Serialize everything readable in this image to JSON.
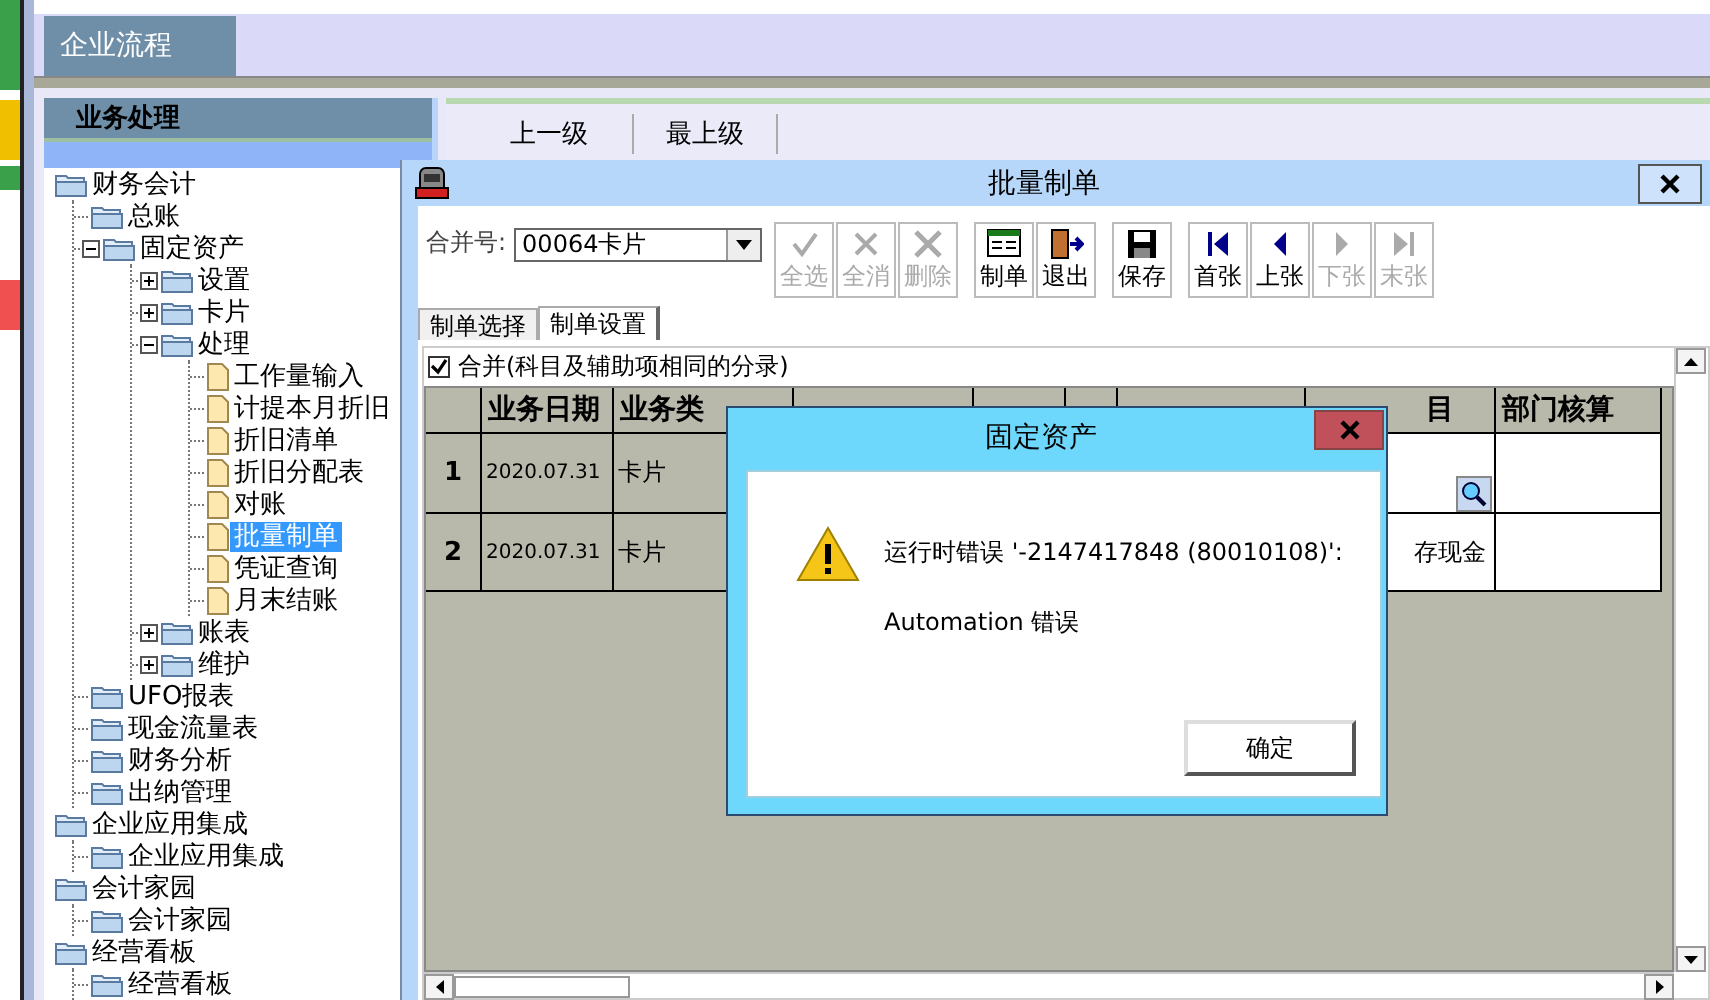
{
  "top_tabs": [
    {
      "label": "企业流程",
      "selected": true
    }
  ],
  "sidebar": {
    "title": "业务处理",
    "tree": [
      {
        "label": "财务会计",
        "kind": "folder",
        "selected": false,
        "children": [
          {
            "label": "总账",
            "kind": "folder",
            "selected": false
          },
          {
            "label": "固定资产",
            "kind": "folder",
            "selected": false,
            "expanded": true,
            "children": [
              {
                "label": "设置",
                "kind": "folder",
                "selected": false,
                "expanded": false
              },
              {
                "label": "卡片",
                "kind": "folder",
                "selected": false,
                "expanded": false
              },
              {
                "label": "处理",
                "kind": "folder",
                "selected": false,
                "expanded": true,
                "children": [
                  {
                    "label": "工作量输入",
                    "kind": "page",
                    "selected": false
                  },
                  {
                    "label": "计提本月折旧",
                    "kind": "page",
                    "selected": false
                  },
                  {
                    "label": "折旧清单",
                    "kind": "page",
                    "selected": false
                  },
                  {
                    "label": "折旧分配表",
                    "kind": "page",
                    "selected": false
                  },
                  {
                    "label": "对账",
                    "kind": "page",
                    "selected": false
                  },
                  {
                    "label": "批量制单",
                    "kind": "page",
                    "selected": true
                  },
                  {
                    "label": "凭证查询",
                    "kind": "page",
                    "selected": false
                  },
                  {
                    "label": "月末结账",
                    "kind": "page",
                    "selected": false
                  }
                ]
              },
              {
                "label": "账表",
                "kind": "folder",
                "selected": false,
                "expanded": false
              },
              {
                "label": "维护",
                "kind": "folder",
                "selected": false,
                "expanded": false
              }
            ]
          },
          {
            "label": "UFO报表",
            "kind": "folder",
            "selected": false
          },
          {
            "label": "现金流量表",
            "kind": "folder",
            "selected": false
          },
          {
            "label": "财务分析",
            "kind": "folder",
            "selected": false
          },
          {
            "label": "出纳管理",
            "kind": "folder",
            "selected": false
          }
        ]
      },
      {
        "label": "企业应用集成",
        "kind": "folder",
        "selected": false,
        "children": [
          {
            "label": "企业应用集成",
            "kind": "folder",
            "selected": false
          }
        ]
      },
      {
        "label": "会计家园",
        "kind": "folder",
        "selected": false,
        "children": [
          {
            "label": "会计家园",
            "kind": "folder",
            "selected": false
          }
        ]
      },
      {
        "label": "经营看板",
        "kind": "folder",
        "selected": false,
        "children": [
          {
            "label": "经营看板",
            "kind": "folder",
            "selected": false
          }
        ]
      }
    ]
  },
  "nav": {
    "links": [
      "上一级",
      "最上级"
    ]
  },
  "batch_window": {
    "title": "批量制单",
    "merge_label": "合并号:",
    "merge_value": "00064卡片",
    "toolbar": [
      {
        "label": "全选",
        "disabled": true
      },
      {
        "label": "全消",
        "disabled": true
      },
      {
        "label": "删除",
        "disabled": true
      },
      {
        "label": "制单",
        "disabled": false
      },
      {
        "label": "退出",
        "disabled": false
      },
      {
        "label": "保存",
        "disabled": false
      },
      {
        "label": "首张",
        "disabled": false
      },
      {
        "label": "上张",
        "disabled": false
      },
      {
        "label": "下张",
        "disabled": true
      },
      {
        "label": "末张",
        "disabled": true
      }
    ],
    "tabs": [
      {
        "label": "制单选择",
        "selected": false
      },
      {
        "label": "制单设置",
        "selected": true
      }
    ],
    "merge_checkbox": {
      "label": "合并(科目及辅助项相同的分录)",
      "checked": true
    },
    "grid": {
      "columns": [
        {
          "label": "业务日期"
        },
        {
          "label": "业务类"
        },
        null,
        null,
        null,
        null,
        {
          "label": "目"
        },
        {
          "label": "部门核算"
        }
      ],
      "rows": [
        {
          "number": "1",
          "editing": true,
          "cells": [
            "2020.07.31",
            "卡片",
            null,
            null,
            null,
            null,
            null,
            null
          ]
        },
        {
          "number": "2",
          "editing": false,
          "cells": [
            "2020.07.31",
            "卡片",
            null,
            null,
            null,
            null,
            "存现金",
            null
          ]
        }
      ]
    }
  },
  "message_box": {
    "title": "固定资产",
    "lines": [
      "运行时错误 '-2147417848 (80010108)':",
      "Automation 错误"
    ],
    "button": "确定"
  }
}
